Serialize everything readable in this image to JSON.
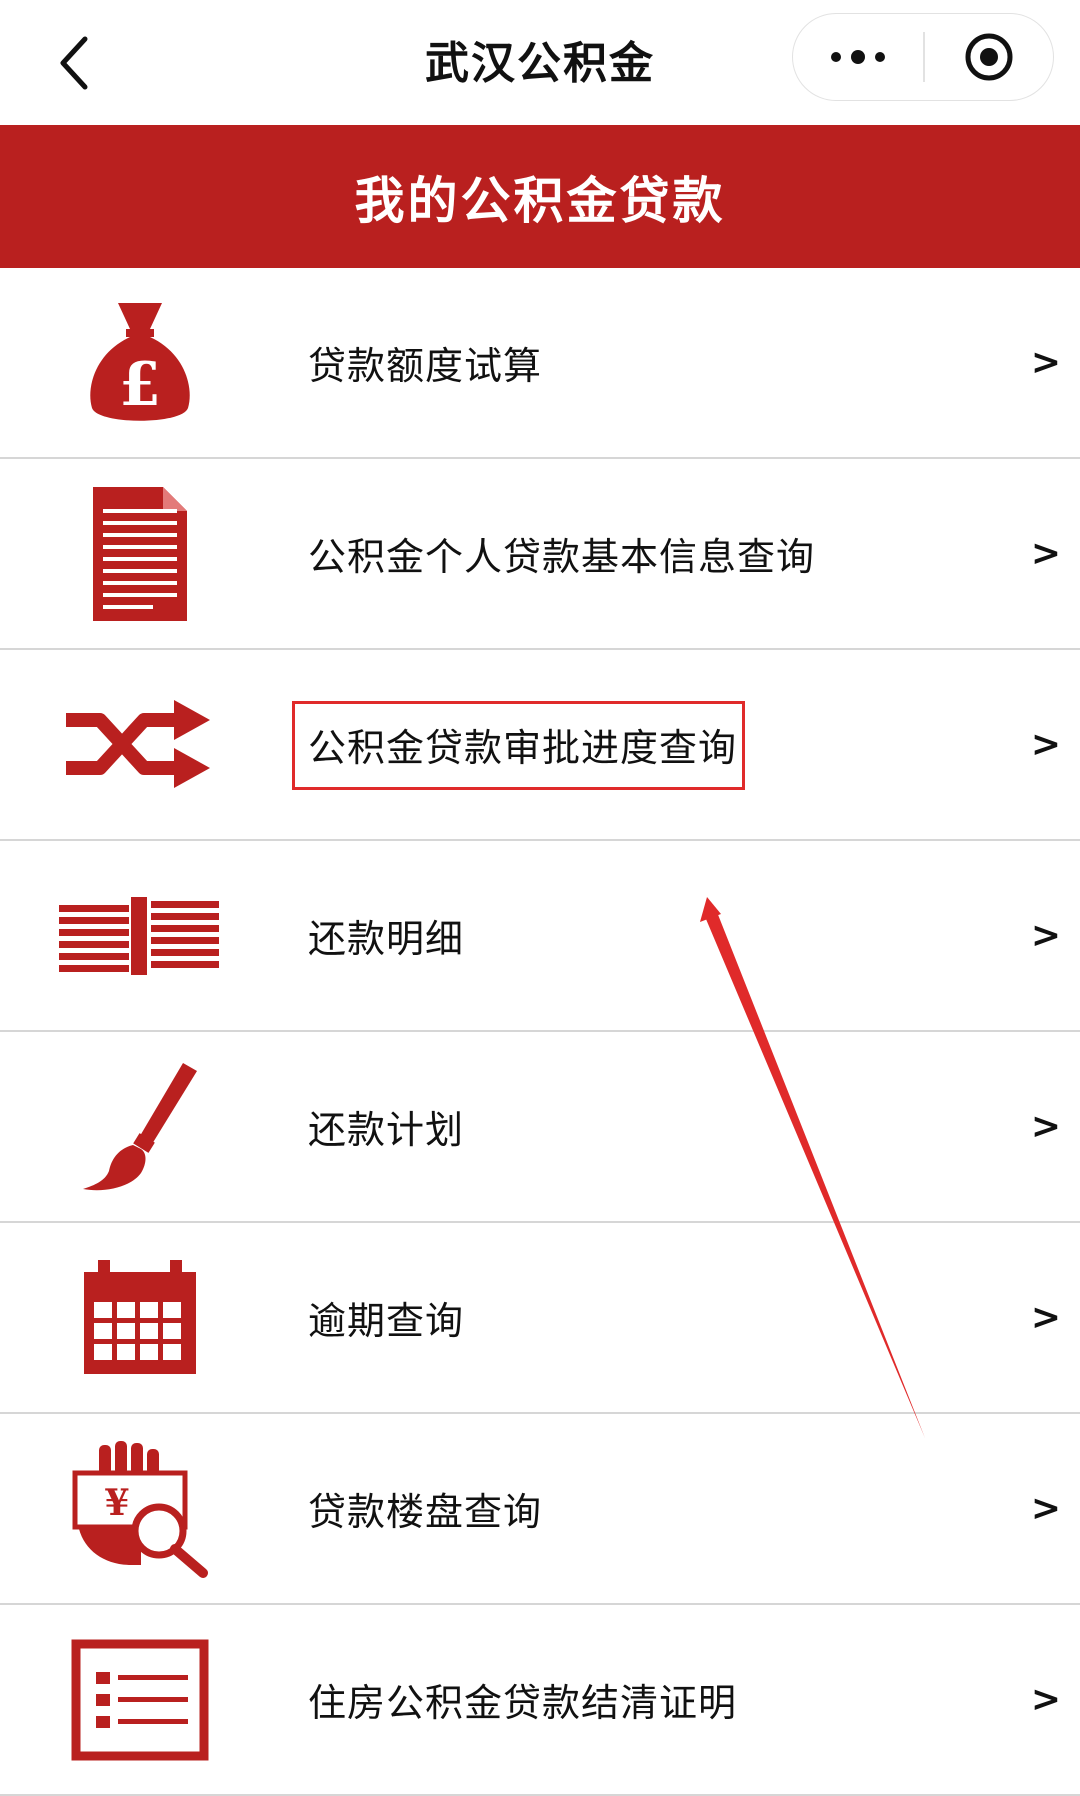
{
  "navbar": {
    "title": "武汉公积金",
    "back_icon": "chevron-left-icon",
    "more_icon": "more-dots-icon",
    "close_icon": "target-circle-icon"
  },
  "banner": {
    "title": "我的公积金贷款"
  },
  "menu": {
    "items": [
      {
        "label": "贷款额度试算",
        "icon": "money-bag-icon",
        "chevron": ">"
      },
      {
        "label": "公积金个人贷款基本信息查询",
        "icon": "document-icon",
        "chevron": ">"
      },
      {
        "label": "公积金贷款审批进度查询",
        "icon": "shuffle-icon",
        "chevron": ">",
        "highlighted": true
      },
      {
        "label": "还款明细",
        "icon": "cash-stacks-icon",
        "chevron": ">"
      },
      {
        "label": "还款计划",
        "icon": "paintbrush-icon",
        "chevron": ">"
      },
      {
        "label": "逾期查询",
        "icon": "calendar-icon",
        "chevron": ">"
      },
      {
        "label": "贷款楼盘查询",
        "icon": "money-search-icon",
        "chevron": ">"
      },
      {
        "label": "住房公积金贷款结清证明",
        "icon": "list-icon",
        "chevron": ">"
      }
    ]
  },
  "colors": {
    "brand_red": "#b9201f",
    "annotation_red": "#e02a2a",
    "divider": "#d6d6d6"
  }
}
